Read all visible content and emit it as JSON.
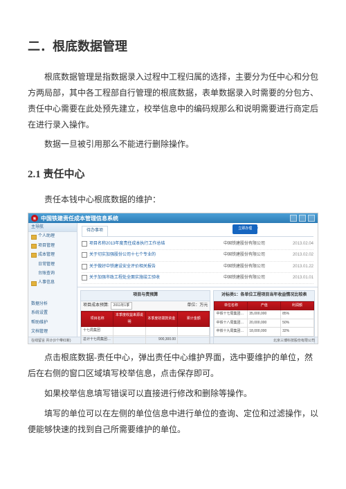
{
  "doc": {
    "h1": "二．根底数据管理",
    "p1": "根底数据管理是指数据录入过程中工程归属的选择，主要分为任中心和分包方两局部，其中各工程部自行管理的根底数据，表单数据录入时需要的分包方、责任中心需要在此处预先建立，校举信息中的编码规那么和说明需要进行商定后在进行录入操作。",
    "p2": "数据一旦被引用那么不能进行删除操作。",
    "h2": "2.1 责任中心",
    "p3": "责任本钱中心根底数据的维护：",
    "p4": "点击根底数据-责任中心，弹出责任中心维护界面，选中要维护的单位，然后在右侧的窗口区域填写校举信息，点击保存即可。",
    "p5": "如果校举信息填写错误可以直接进行修改和删除等操作。",
    "p6": "填写的单位可以在左侧的单位信息中进行单位的查询、定位和过滤操作，以便能够快速的找到自己所需要维护的单位。"
  },
  "app": {
    "title": "中国铁建责任成本管理信息系统",
    "sidebar_header": "主导航",
    "sidebar": [
      "个人助理",
      "项目管理",
      "成本管理",
      "人事信息",
      "数据分析",
      "系统设置",
      "帮助维护",
      "文档管理"
    ],
    "sub_items": [
      "日常管理",
      "台账查询"
    ],
    "arrow_label": "立即办理",
    "tabs": [
      "待办事项"
    ],
    "list": [
      {
        "title": "项目名称2013年度责任成本执行工作总结",
        "company": "中国铁建股份有限公司",
        "date": "2013.02.04"
      },
      {
        "title": "关于切实加强股份公司十七个专业的",
        "company": "中国铁建股份有限公司",
        "date": "2013.02.02"
      },
      {
        "title": "关于做好中铁建设安全评价相关报告",
        "company": "中国铁建股份有限公司",
        "date": "2013.01.22"
      },
      {
        "title": "关于加强市政工程处全面实施竣工验收",
        "company": "中国铁建股份有限公司",
        "date": "2013.01.01"
      }
    ],
    "panel_left": {
      "title": "项目与责预算",
      "proj_label": "项目成本预算:",
      "proj_value": "2011年1季",
      "proj_suffix": "单位：万元",
      "columns": [
        "项目名称",
        "本季度收益来源说明",
        "本季度初拨款资金",
        "累计金额"
      ],
      "rows": [
        {
          "name": "十七局集团",
          "v1": "",
          "v2": "",
          "v3": ""
        },
        {
          "name": "总计十七局集团一工程项目有限公司",
          "v1": "",
          "v2": "900,300.00",
          "v3": ""
        }
      ]
    },
    "panel_right": {
      "title": "对标类1：各单位工程项目当年收益情况比较表",
      "columns": [
        "单位名称",
        "产值",
        "利润额"
      ],
      "rows": [
        {
          "name": "中铁十七局集团有限公司",
          "v1": "35,000,000",
          "v2": "85%"
        },
        {
          "name": "中铁十八局集团有限公司",
          "v1": "20,000,000",
          "v2": "50%"
        },
        {
          "name": "中铁十九局集团有限公司",
          "v1": "18,000,000",
          "v2": "32%"
        }
      ]
    },
    "footer_left": "在线留言 共计(0个带红新)",
    "footer_right": "北京三博科技股份有限公司"
  }
}
